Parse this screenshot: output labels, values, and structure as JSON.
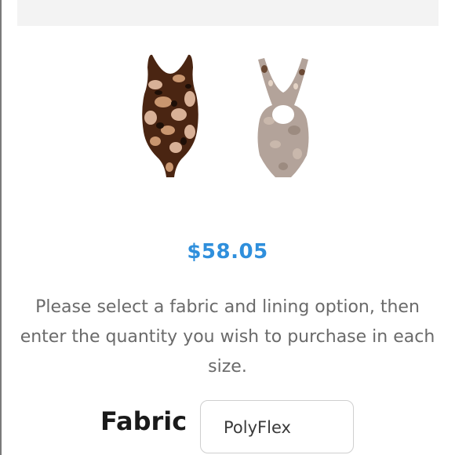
{
  "product": {
    "images": [
      {
        "view": "front",
        "icon": "swimsuit-front-image"
      },
      {
        "view": "back",
        "icon": "swimsuit-back-image"
      }
    ],
    "price": "$58.05"
  },
  "instructions": "Please select a fabric and lining option, then enter the quantity you wish to purchase in each size.",
  "fabric": {
    "label": "Fabric",
    "selected": "PolyFlex"
  },
  "colors": {
    "price": "#2f8fdc",
    "print_dark": "#4a2512",
    "print_light": "#d8b197",
    "back_base": "#b3a39a"
  }
}
